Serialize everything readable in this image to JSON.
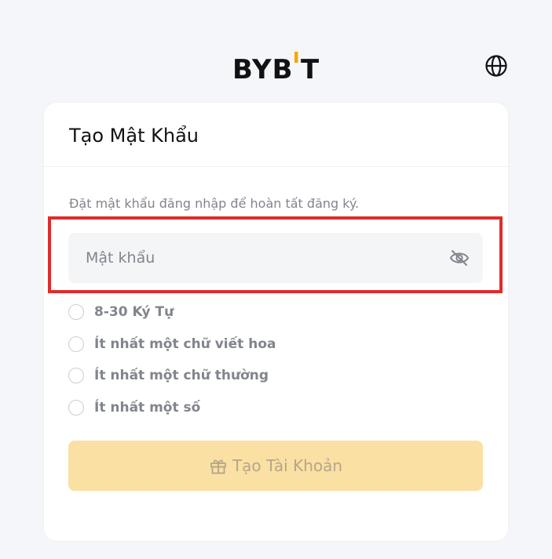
{
  "brand": {
    "logo_text": "BYB",
    "logo_text_end": "T",
    "accent_color": "#f7a600"
  },
  "header": {
    "language_icon": "globe-icon"
  },
  "card": {
    "title": "Tạo Mật Khẩu",
    "subtitle": "Đặt mật khẩu đăng nhập để hoàn tất đăng ký.",
    "password_field": {
      "placeholder": "Mật khẩu",
      "value": "",
      "toggle_icon": "eye-off-icon"
    },
    "requirements": [
      {
        "label": "8-30 Ký Tự",
        "met": false
      },
      {
        "label": "Ít nhất một chữ viết hoa",
        "met": false
      },
      {
        "label": "Ít nhất một chữ thường",
        "met": false
      },
      {
        "label": "Ít nhất một số",
        "met": false
      }
    ],
    "submit_button": {
      "label": "Tạo Tài Khoản",
      "icon": "gift-icon",
      "enabled": false,
      "color": "#fbe0a3"
    }
  },
  "annotation": {
    "highlight_color": "#e02b2b"
  }
}
